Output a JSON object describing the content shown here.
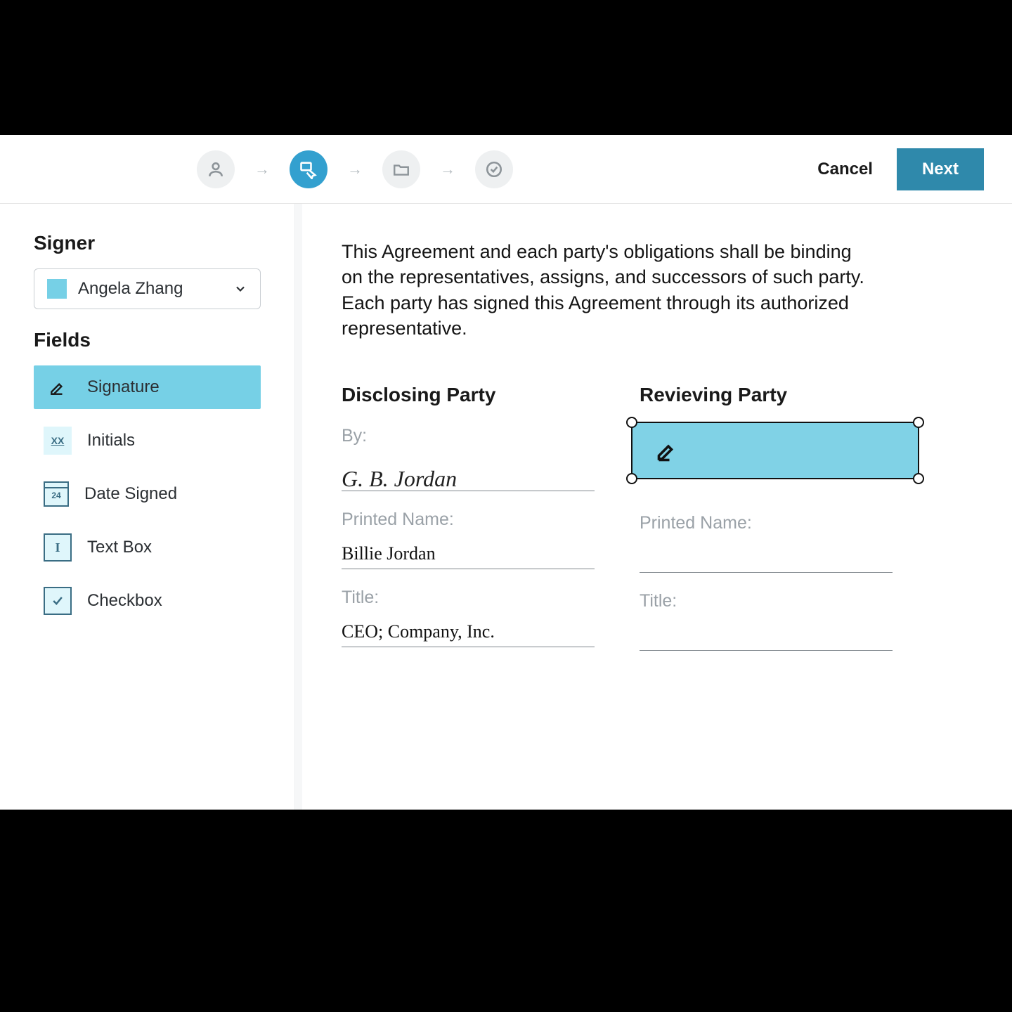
{
  "topbar": {
    "cancel_label": "Cancel",
    "next_label": "Next"
  },
  "sidebar": {
    "signer_heading": "Signer",
    "fields_heading": "Fields",
    "selected_signer": "Angela Zhang",
    "fields": {
      "signature": "Signature",
      "initials": "Initials",
      "date_signed": "Date Signed",
      "text_box": "Text Box",
      "checkbox": "Checkbox"
    }
  },
  "document": {
    "agreement_text": "This Agreement and each party's obligations shall be binding on the representatives, assigns, and successors of such party. Each party has signed this Agreement through its authorized representative.",
    "disclosing": {
      "heading": "Disclosing Party",
      "by_label": "By:",
      "signature_display": "G. B. Jordan",
      "printed_name_label": "Printed Name:",
      "printed_name_value": "Billie Jordan",
      "title_label": "Title:",
      "title_value": "CEO; Company, Inc."
    },
    "reviewing": {
      "heading": "Revieving Party",
      "printed_name_label": "Printed Name:",
      "printed_name_value": "",
      "title_label": "Title:",
      "title_value": ""
    }
  },
  "icons": {
    "initials_text": "XX",
    "date_text": "24",
    "textbox_text": "I"
  }
}
